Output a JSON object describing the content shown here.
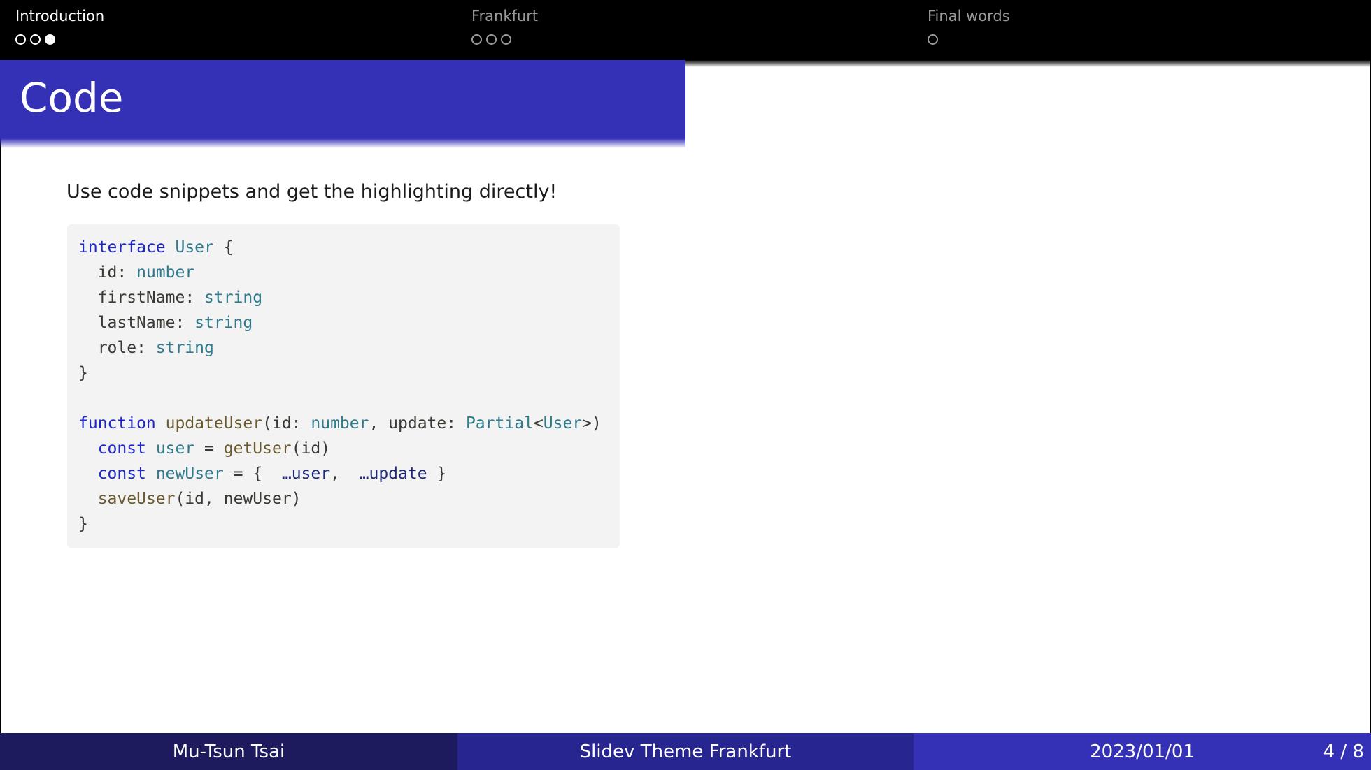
{
  "nav": {
    "sections": [
      {
        "title": "Introduction",
        "active": true,
        "dots": [
          false,
          false,
          true
        ]
      },
      {
        "title": "Frankfurt",
        "active": false,
        "dots": [
          false,
          false,
          false
        ]
      },
      {
        "title": "Final words",
        "active": false,
        "dots": [
          false
        ]
      }
    ]
  },
  "slide": {
    "title": "Code",
    "intro": "Use code snippets and get the highlighting directly!"
  },
  "code": {
    "language": "typescript",
    "lines": [
      [
        [
          "kw",
          "interface"
        ],
        [
          "p",
          " "
        ],
        [
          "type",
          "User"
        ],
        [
          "p",
          " {"
        ]
      ],
      [
        [
          "p",
          "  id: "
        ],
        [
          "type",
          "number"
        ]
      ],
      [
        [
          "p",
          "  firstName: "
        ],
        [
          "type",
          "string"
        ]
      ],
      [
        [
          "p",
          "  lastName: "
        ],
        [
          "type",
          "string"
        ]
      ],
      [
        [
          "p",
          "  role: "
        ],
        [
          "type",
          "string"
        ]
      ],
      [
        [
          "p",
          "}"
        ]
      ],
      [],
      [
        [
          "kw",
          "function"
        ],
        [
          "p",
          " "
        ],
        [
          "fn",
          "updateUser"
        ],
        [
          "p",
          "(id: "
        ],
        [
          "type",
          "number"
        ],
        [
          "p",
          ", update: "
        ],
        [
          "type",
          "Partial"
        ],
        [
          "p",
          "<"
        ],
        [
          "type",
          "User"
        ],
        [
          "p",
          ">)"
        ]
      ],
      [
        [
          "p",
          "  "
        ],
        [
          "kw",
          "const"
        ],
        [
          "p",
          " "
        ],
        [
          "type",
          "user"
        ],
        [
          "p",
          " = "
        ],
        [
          "fn",
          "getUser"
        ],
        [
          "p",
          "(id)"
        ]
      ],
      [
        [
          "p",
          "  "
        ],
        [
          "kw",
          "const"
        ],
        [
          "p",
          " "
        ],
        [
          "type",
          "newUser"
        ],
        [
          "p",
          " = {  "
        ],
        [
          "var",
          "…user"
        ],
        [
          "p",
          ",  "
        ],
        [
          "var",
          "…update"
        ],
        [
          "p",
          " }"
        ]
      ],
      [
        [
          "p",
          "  "
        ],
        [
          "fn",
          "saveUser"
        ],
        [
          "p",
          "(id, newUser)"
        ]
      ],
      [
        [
          "p",
          "}"
        ]
      ]
    ]
  },
  "footer": {
    "author": "Mu-Tsun Tsai",
    "title": "Slidev Theme Frankfurt",
    "date": "2023/01/01",
    "page": "4 / 8"
  },
  "colors": {
    "accent": "#3431b6",
    "footer_dark": "#1d1b5e",
    "footer_mid": "#272590",
    "keyword": "#1e28c8",
    "type": "#2f7a8c",
    "function": "#6b5a2f"
  }
}
